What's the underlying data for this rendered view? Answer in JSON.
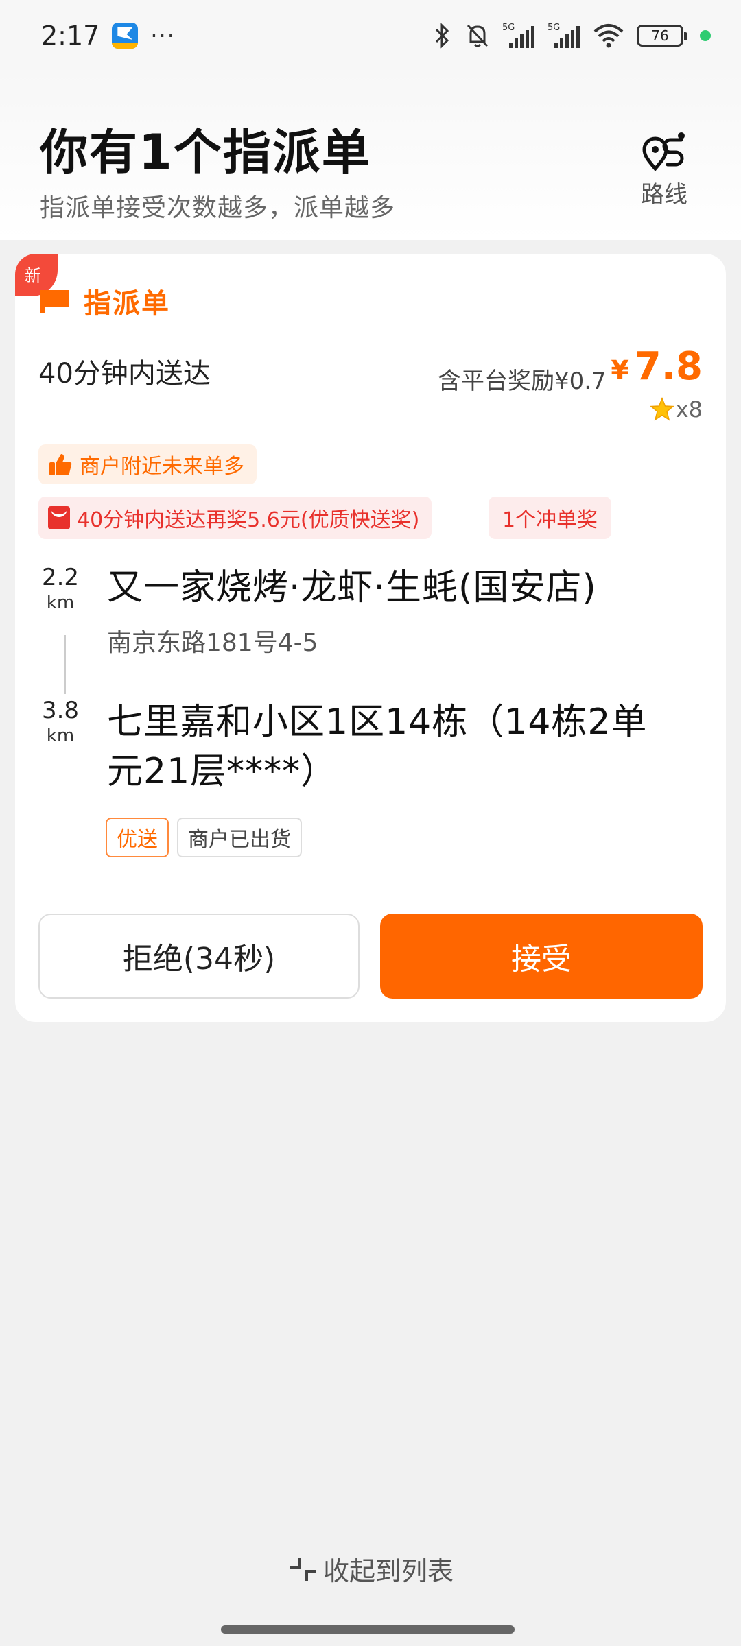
{
  "status_bar": {
    "time": "2:17",
    "more": "···",
    "network_1": "5G",
    "network_2": "5G",
    "battery": "76",
    "icons": [
      "app-icon",
      "bluetooth-icon",
      "mute-bell-icon",
      "signal-icon",
      "signal-icon",
      "wifi-icon",
      "battery-icon"
    ]
  },
  "header": {
    "title": "你有1个指派单",
    "subtitle": "指派单接受次数越多，派单越多",
    "route_label": "路线"
  },
  "order": {
    "new_badge": "新",
    "type_label": "指派单",
    "delivery_time": "40分钟内送达",
    "reward_text": "含平台奖励¥0.7",
    "price_symbol": "¥",
    "price": "7.8",
    "star_count": "x8",
    "tags": {
      "merchant": "商户附近未来单多",
      "bonus": "40分钟内送达再奖5.6元(优质快送奖)",
      "rush": "1个冲单奖"
    },
    "pickup": {
      "distance": "2.2",
      "unit": "km",
      "name": "又一家烧烤·龙虾·生蚝(国安店)",
      "address": "南京东路181号4-5"
    },
    "dropoff": {
      "distance": "3.8",
      "unit": "km",
      "name_line1": "七里嘉和小区1区14栋（14栋2单",
      "name_line2": "元21层****）"
    },
    "order_tags": {
      "fast": "优送",
      "shipped": "商户已出货"
    },
    "reject_label": "拒绝(34秒)",
    "accept_label": "接受"
  },
  "footer": {
    "collapse_label": "收起到列表"
  },
  "colors": {
    "accent": "#ff6600",
    "bonus_red": "#e8312c",
    "badge_red": "#f34a3a"
  }
}
